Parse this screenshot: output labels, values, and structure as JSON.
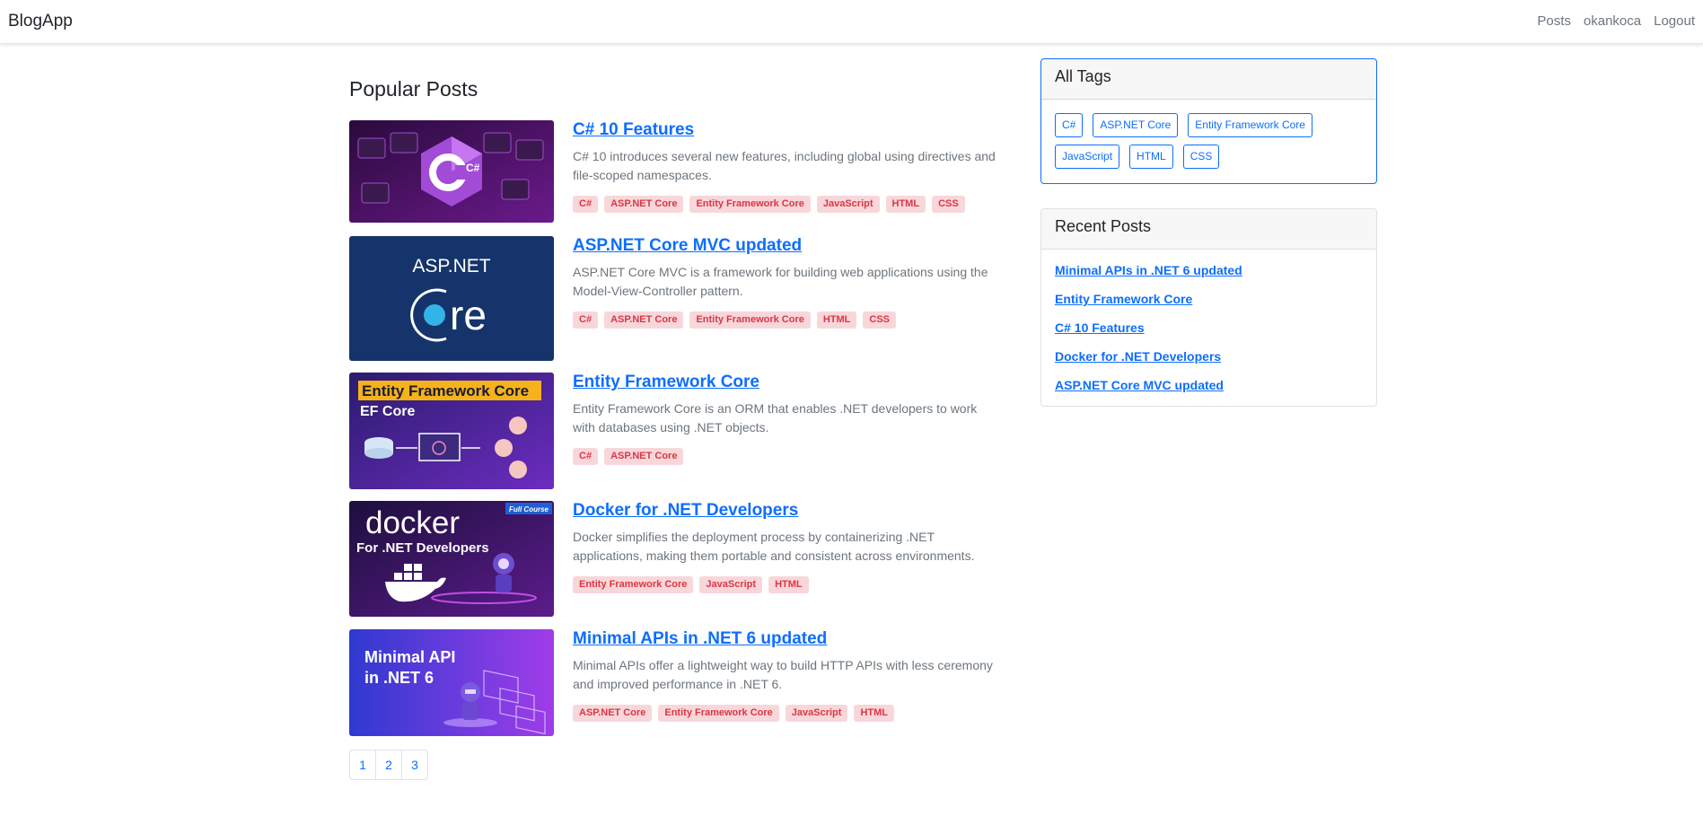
{
  "navbar": {
    "brand": "BlogApp",
    "links": [
      "Posts",
      "okankoca",
      "Logout"
    ]
  },
  "main": {
    "title": "Popular Posts",
    "posts": [
      {
        "title": "C# 10 Features",
        "description": "C# 10 introduces several new features, including global using directives and file-scoped namespaces.",
        "tags": [
          "C#",
          "ASP.NET Core",
          "Entity Framework Core",
          "JavaScript",
          "HTML",
          "CSS"
        ],
        "thumb_text": [
          "C#"
        ]
      },
      {
        "title": "ASP.NET Core MVC updated",
        "description": "ASP.NET Core MVC is a framework for building web applications using the Model-View-Controller pattern.",
        "tags": [
          "C#",
          "ASP.NET Core",
          "Entity Framework Core",
          "HTML",
          "CSS"
        ],
        "thumb_text": [
          "ASP.NET",
          "re"
        ]
      },
      {
        "title": "Entity Framework Core",
        "description": "Entity Framework Core is an ORM that enables .NET developers to work with databases using .NET objects.",
        "tags": [
          "C#",
          "ASP.NET Core"
        ],
        "thumb_text": [
          "Entity Framework Core",
          "EF Core"
        ]
      },
      {
        "title": "Docker for .NET Developers",
        "description": "Docker simplifies the deployment process by containerizing .NET applications, making them portable and consistent across environments.",
        "tags": [
          "Entity Framework Core",
          "JavaScript",
          "HTML"
        ],
        "thumb_text": [
          "docker",
          "For .NET Developers",
          "Full Course"
        ]
      },
      {
        "title": "Minimal APIs in .NET 6 updated",
        "description": "Minimal APIs offer a lightweight way to build HTTP APIs with less ceremony and improved performance in .NET 6.",
        "tags": [
          "ASP.NET Core",
          "Entity Framework Core",
          "JavaScript",
          "HTML"
        ],
        "thumb_text": [
          "Minimal API",
          "in .NET 6"
        ]
      }
    ],
    "pagination": [
      "1",
      "2",
      "3"
    ]
  },
  "sidebar": {
    "tags_title": "All Tags",
    "tags": [
      "C#",
      "ASP.NET Core",
      "Entity Framework Core",
      "JavaScript",
      "HTML",
      "CSS"
    ],
    "recent_title": "Recent Posts",
    "recent": [
      "Minimal APIs in .NET 6 updated",
      "Entity Framework Core",
      "C# 10 Features",
      "Docker for .NET Developers",
      "ASP.NET Core MVC updated"
    ]
  },
  "colors": {
    "link": "#0d6efd",
    "tag_text": "#dc3545",
    "tag_bg": "#f8d7da"
  }
}
